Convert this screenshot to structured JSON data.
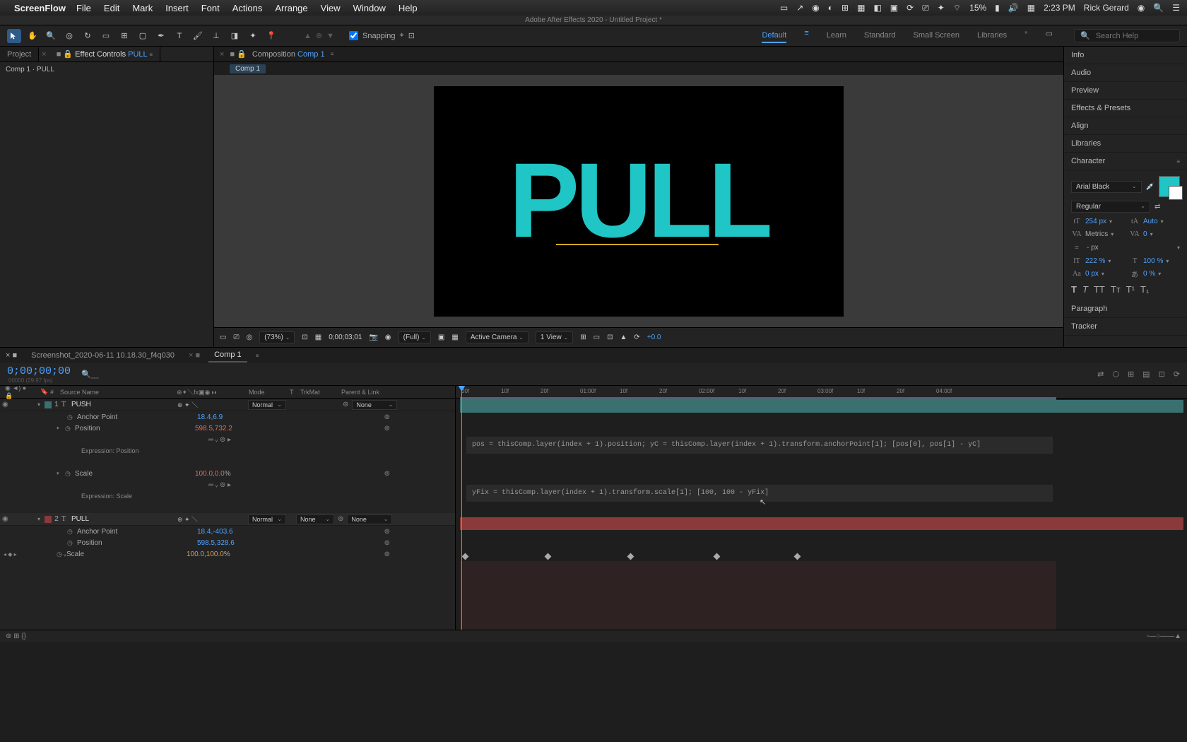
{
  "menubar": {
    "app": "ScreenFlow",
    "items": [
      "File",
      "Edit",
      "Mark",
      "Insert",
      "Font",
      "Actions",
      "Arrange",
      "View",
      "Window",
      "Help"
    ],
    "battery": "15%",
    "time": "2:23 PM",
    "user": "Rick Gerard"
  },
  "titlebar": "Adobe After Effects 2020 - Untitled Project *",
  "toolbar": {
    "snapping": "Snapping"
  },
  "workspaces": [
    "Default",
    "Learn",
    "Standard",
    "Small Screen",
    "Libraries"
  ],
  "search_placeholder": "Search Help",
  "left_panel": {
    "tabs": [
      "Project",
      "Effect Controls PULL"
    ],
    "sub": "Comp 1 · PULL"
  },
  "comp": {
    "label": "Composition",
    "name": "Comp 1",
    "pill": "Comp 1",
    "preview_text": "PULL"
  },
  "viewer": {
    "zoom": "(73%)",
    "time": "0;00;03;01",
    "res": "(Full)",
    "camera": "Active Camera",
    "view": "1 View",
    "exp": "+0.0"
  },
  "right": {
    "items": [
      "Info",
      "Audio",
      "Preview",
      "Effects & Presets",
      "Align",
      "Libraries",
      "Character"
    ],
    "font": "Arial Black",
    "style": "Regular",
    "size": "254 px",
    "leading": "Auto",
    "kerning": "Metrics",
    "tracking": "0",
    "stroke": "- px",
    "vscale": "222 %",
    "hscale": "100 %",
    "baseline": "0 px",
    "tsume": "0 %",
    "paragraph": "Paragraph",
    "tracker": "Tracker"
  },
  "bottom": {
    "tabs": [
      "Screenshot_2020-06-11 10.18.30_f4q030",
      "Comp 1"
    ],
    "timecode": "0;00;00;00",
    "timecode_sub": "00000 (29.97 fps)"
  },
  "cols": {
    "num": "#",
    "src": "Source Name",
    "mode": "Mode",
    "t": "T",
    "trk": "TrkMat",
    "parent": "Parent & Link"
  },
  "ruler": [
    "00f",
    "10f",
    "20f",
    "01:00f",
    "10f",
    "20f",
    "02:00f",
    "10f",
    "20f",
    "03:00f",
    "10f",
    "20f",
    "04:00f"
  ],
  "layer1": {
    "num": "1",
    "name": "PUSH",
    "mode": "Normal",
    "parent": "None",
    "anchor_label": "Anchor Point",
    "anchor_val": "18.4,6.9",
    "pos_label": "Position",
    "pos_val": "598.5,732.2",
    "expr_pos": "Expression: Position",
    "scale_label": "Scale",
    "scale_val": "100.0,0.0",
    "scale_pct": "%",
    "expr_scale": "Expression: Scale"
  },
  "layer2": {
    "num": "2",
    "name": "PULL",
    "mode": "Normal",
    "trk": "None",
    "parent": "None",
    "anchor_label": "Anchor Point",
    "anchor_val": "18.4,-403.6",
    "pos_label": "Position",
    "pos_val": "598.5,328.6",
    "scale_label": "Scale",
    "scale_val": "100.0,100.0",
    "scale_pct": "%"
  },
  "expr1": "pos = thisComp.layer(index + 1).position;\nyC = thisComp.layer(index + 1).transform.anchorPoint[1];\n[pos[0], pos[1] - yC]",
  "expr2": "yFix = thisComp.layer(index + 1).transform.scale[1];\n[100, 100 - yFix]"
}
